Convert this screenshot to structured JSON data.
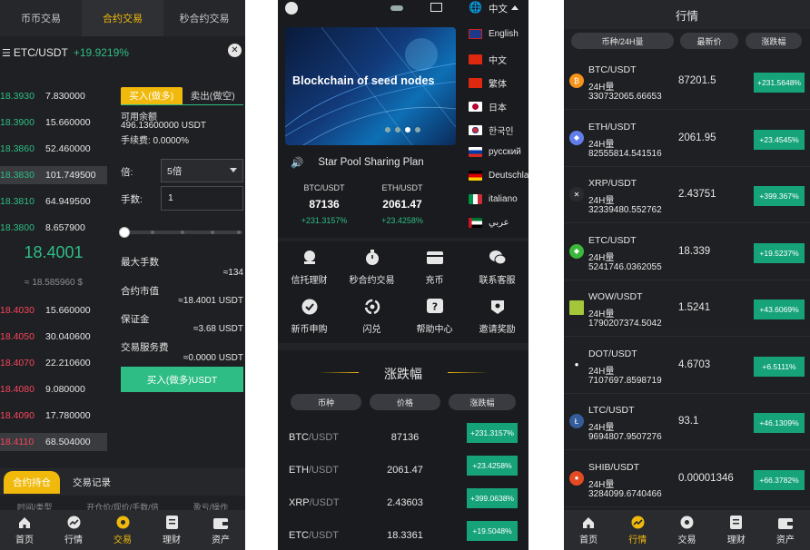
{
  "screen1": {
    "tabs": [
      "币币交易",
      "合约交易",
      "秒合约交易"
    ],
    "pair": "ETC/USDT",
    "change": "+19.9219%",
    "asks_top": [
      {
        "price": "18.3930",
        "qty": "7.830000"
      },
      {
        "price": "18.3900",
        "qty": "15.660000"
      },
      {
        "price": "18.3860",
        "qty": "52.460000"
      },
      {
        "price": "18.3830",
        "qty": "101.749500"
      },
      {
        "price": "18.3810",
        "qty": "64.949500"
      },
      {
        "price": "18.3800",
        "qty": "8.657900"
      }
    ],
    "mid_price": "18.4001",
    "mid_sub": "≈ 18.585960 $",
    "bids": [
      {
        "price": "18.4030",
        "qty": "15.660000"
      },
      {
        "price": "18.4050",
        "qty": "30.040600"
      },
      {
        "price": "18.4070",
        "qty": "22.210600"
      },
      {
        "price": "18.4080",
        "qty": "9.080000"
      },
      {
        "price": "18.4090",
        "qty": "17.780000"
      },
      {
        "price": "18.4110",
        "qty": "68.504000"
      }
    ],
    "trade_tabs": [
      "买入(做多)",
      "卖出(做空)"
    ],
    "available_label": "可用余额",
    "available_value": "496.13600000 USDT",
    "fee": "手续费:  0.0000%",
    "leverage_label": "倍:",
    "leverage_value": "5倍",
    "qty_label": "手数:",
    "qty_value": "1",
    "max_lots_label": "最大手数",
    "max_lots_value": "≈134",
    "contract_value_label": "合约市值",
    "contract_value_value": "≈18.4001 USDT",
    "margin_label": "保证金",
    "margin_value": "≈3.68 USDT",
    "service_fee_label": "交易服务费",
    "service_fee_value": "≈0.0000 USDT",
    "buy_button": "买入(做多)USDT",
    "pos_tabs": [
      "合约持仓",
      "交易记录"
    ],
    "pos_cols": [
      "时间/类型",
      "开仓价/现价/手数/倍",
      "盈亏/操作"
    ]
  },
  "tabbar": {
    "items": [
      "首页",
      "行情",
      "交易",
      "理财",
      "资产"
    ]
  },
  "screen2": {
    "banner_text": "Blockchain of seed nodes",
    "languages": [
      "English",
      "中文",
      "繁体",
      "日本",
      "한국인",
      "русский",
      "Deutschland",
      "italiano",
      "عربي"
    ],
    "lang_current": "中文",
    "notice": "Star Pool Sharing Plan",
    "tickers": [
      {
        "name": "BTC/USDT",
        "value": "87136",
        "change": "+231.3157%"
      },
      {
        "name": "ETH/USDT",
        "value": "2061.47",
        "change": "+23.4258%"
      }
    ],
    "functions": [
      "信托理财",
      "秒合约交易",
      "充币",
      "联系客服",
      "新币申购",
      "闪兑",
      "帮助中心",
      "邀请奖励"
    ],
    "section_title": "涨跌幅",
    "col_headers": [
      "币种",
      "价格",
      "涨跌幅"
    ],
    "rows": [
      {
        "base": "BTC",
        "quote": "/USDT",
        "price": "87136",
        "change": "+231.3157%"
      },
      {
        "base": "ETH",
        "quote": "/USDT",
        "price": "2061.47",
        "change": "+23.4258%"
      },
      {
        "base": "XRP",
        "quote": "/USDT",
        "price": "2.43603",
        "change": "+399.0638%"
      },
      {
        "base": "ETC",
        "quote": "/USDT",
        "price": "18.3361",
        "change": "+19.5048%"
      }
    ]
  },
  "screen3": {
    "title": "行情",
    "col_headers": [
      "币种/24H量",
      "最新价",
      "涨跌幅"
    ],
    "vol_label": "24H量",
    "rows": [
      {
        "sym": "BTC/USDT",
        "vol": "330732065.66653",
        "price": "87201.5",
        "change": "+231.5648%",
        "color": "#f7931a",
        "glyph": "₿"
      },
      {
        "sym": "ETH/USDT",
        "vol": "82555814.541516",
        "price": "2061.95",
        "change": "+23.4545%",
        "color": "#627eea",
        "glyph": "◆"
      },
      {
        "sym": "XRP/USDT",
        "vol": "32339480.552762",
        "price": "2.43751",
        "change": "+399.367%",
        "color": "#2a2b2f",
        "glyph": "✕"
      },
      {
        "sym": "ETC/USDT",
        "vol": "5241746.0362055",
        "price": "18.339",
        "change": "+19.5237%",
        "color": "#3ab83a",
        "glyph": "◆"
      },
      {
        "sym": "WOW/USDT",
        "vol": "1790207374.5042",
        "price": "1.5241",
        "change": "+43.6069%",
        "color": "#a4c639",
        "glyph": ""
      },
      {
        "sym": "DOT/USDT",
        "vol": "7107697.8598719",
        "price": "4.6703",
        "change": "+6.5111%",
        "color": "#1f2023",
        "glyph": "●"
      },
      {
        "sym": "LTC/USDT",
        "vol": "9694807.9507276",
        "price": "93.1",
        "change": "+46.1309%",
        "color": "#345d9d",
        "glyph": "Ł"
      },
      {
        "sym": "SHIB/USDT",
        "vol": "3284099.6740466",
        "price": "0.00001346",
        "change": "+66.3782%",
        "color": "#e44b23",
        "glyph": "●"
      }
    ]
  }
}
